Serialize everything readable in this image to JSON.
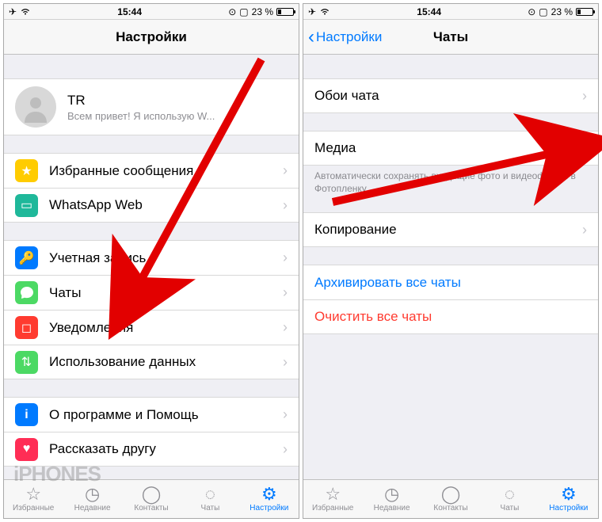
{
  "statusbar": {
    "time": "15:44",
    "battery": "23 %"
  },
  "left": {
    "nav_title": "Настройки",
    "profile": {
      "name": "TR",
      "status": "Всем привет! Я использую W..."
    },
    "group2": {
      "starred": "Избранные сообщения",
      "web": "WhatsApp Web"
    },
    "group3": {
      "account": "Учетная запись",
      "chats": "Чаты",
      "notifications": "Уведомления",
      "data": "Использование данных"
    },
    "group4": {
      "about": "О программе и Помощь",
      "tell": "Рассказать другу"
    }
  },
  "right": {
    "back": "Настройки",
    "nav_title": "Чаты",
    "wallpaper": "Обои чата",
    "media": "Медиа",
    "media_footer": "Автоматически сохранять входящие фото и видеофайлы в Фотопленку.",
    "backup": "Копирование",
    "archive": "Архивировать все чаты",
    "clear": "Очистить все чаты"
  },
  "tabs": {
    "favorites": "Избранные",
    "recents": "Недавние",
    "contacts": "Контакты",
    "chats": "Чаты",
    "settings": "Настройки"
  },
  "watermark": "iPHONES"
}
